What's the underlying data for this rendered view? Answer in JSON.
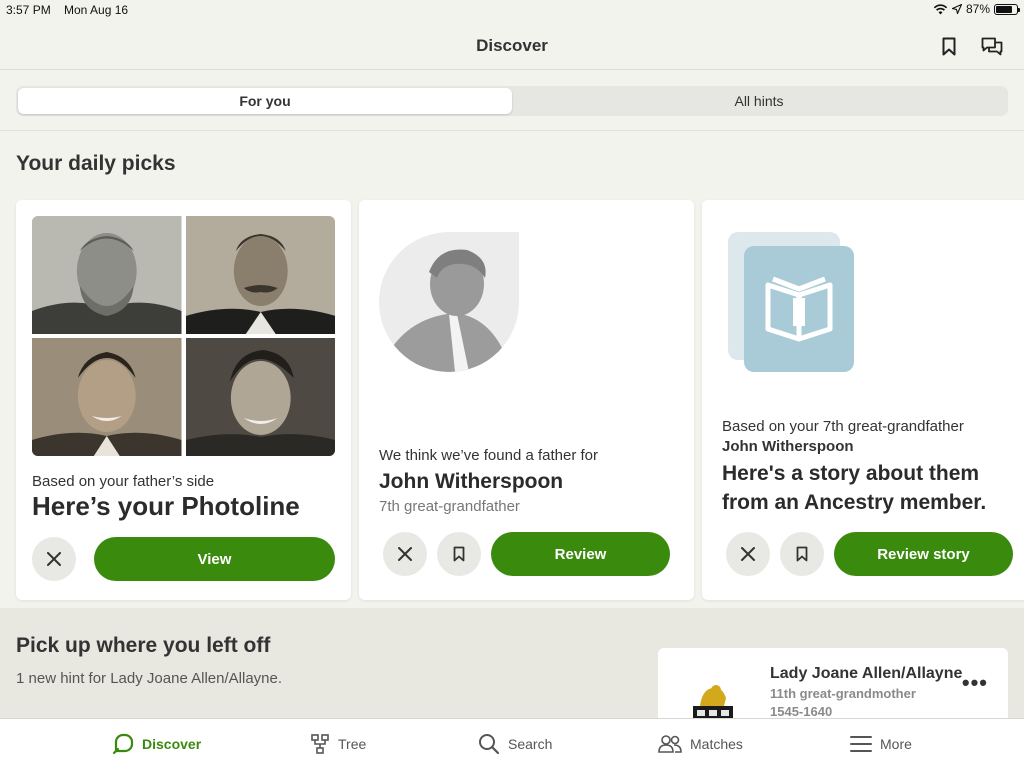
{
  "status_bar": {
    "time": "3:57 PM",
    "date": "Mon Aug 16",
    "battery": "87%"
  },
  "header": {
    "title": "Discover"
  },
  "segments": [
    {
      "label": "For you",
      "active": true
    },
    {
      "label": "All hints",
      "active": false
    }
  ],
  "daily_picks": {
    "title": "Your daily picks",
    "cards": [
      {
        "subtitle": "Based on your father’s side",
        "title": "Here’s your Photoline",
        "action": "View"
      },
      {
        "subtitle": "We think we’ve found a father for",
        "name": "John Witherspoon",
        "relation": "7th great-grandfather",
        "action": "Review"
      },
      {
        "subtitle": "Based on your 7th great-grandfather",
        "name": "John Witherspoon",
        "title": "Here's a story about them from an Ancestry member.",
        "action": "Review story"
      }
    ]
  },
  "pick_up": {
    "title": "Pick up where you left off",
    "subtitle": "1 new hint for Lady Joane Allen/Allayne.",
    "person": {
      "name": "Lady Joane Allen/Allayne",
      "relation": "11th great-grandmother",
      "dates": "1545-1640",
      "menu": "•••"
    }
  },
  "tabs": [
    {
      "label": "Discover",
      "icon": "discover-icon",
      "active": true
    },
    {
      "label": "Tree",
      "icon": "tree-icon",
      "active": false
    },
    {
      "label": "Search",
      "icon": "search-icon",
      "active": false
    },
    {
      "label": "Matches",
      "icon": "matches-icon",
      "active": false
    },
    {
      "label": "More",
      "icon": "menu-icon",
      "active": false
    }
  ],
  "colors": {
    "accent": "#3a8a0e",
    "background": "#f3f3ee",
    "story_icon": "#a9cbd8"
  }
}
